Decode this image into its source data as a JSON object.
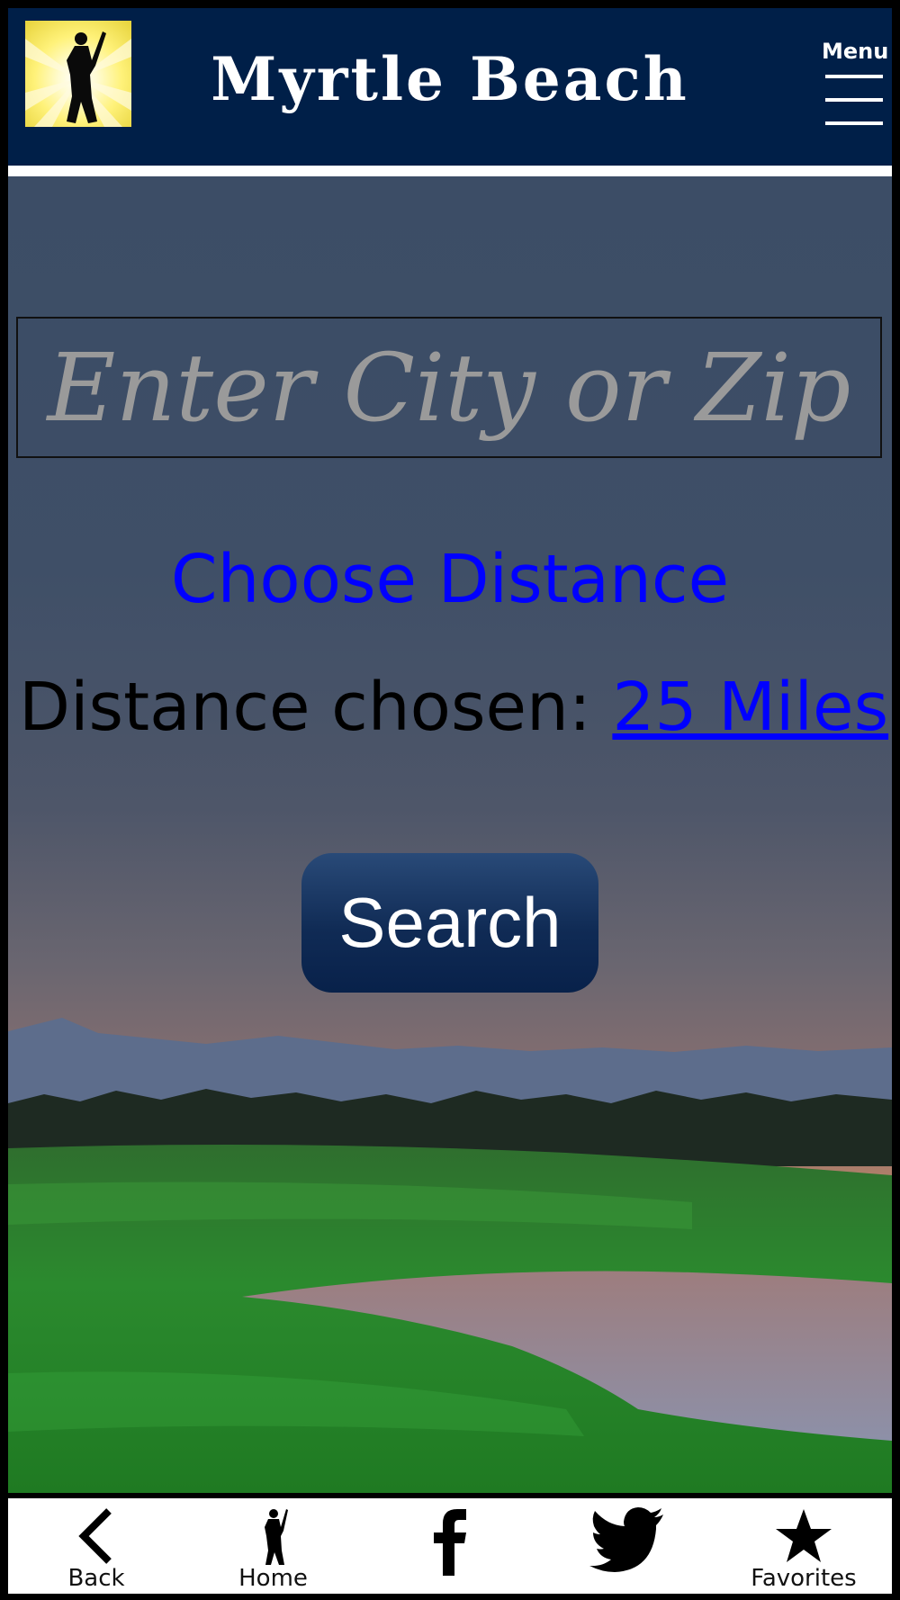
{
  "header": {
    "title": "Myrtle Beach",
    "menu_label": "Menu"
  },
  "search": {
    "placeholder": "Enter City or Zip",
    "value": "",
    "button_label": "Search"
  },
  "distance": {
    "choose_label": "Choose Distance",
    "chosen_prefix": "Distance chosen: ",
    "chosen_value": "25 Miles"
  },
  "bottom_nav": {
    "items": [
      {
        "label": "Back",
        "icon": "chevron-left-icon"
      },
      {
        "label": "Home",
        "icon": "golfer-icon"
      },
      {
        "label": "",
        "icon": "facebook-icon"
      },
      {
        "label": "",
        "icon": "twitter-icon"
      },
      {
        "label": "Favorites",
        "icon": "star-icon"
      }
    ]
  },
  "colors": {
    "header_bg": "#001f48",
    "link_blue": "#0000ff",
    "button_bg": "#102b55"
  }
}
